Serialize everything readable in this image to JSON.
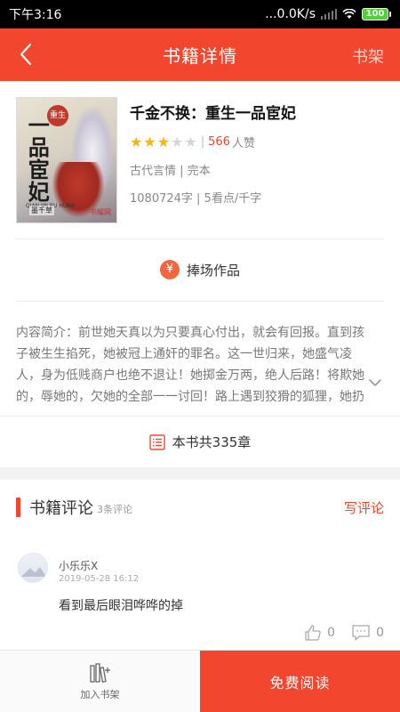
{
  "status_bar": {
    "time": "下午3:16",
    "network_speed": "...0.0K/s",
    "battery": "100"
  },
  "header": {
    "back_icon": "chevron-left-icon",
    "title": "书籍详情",
    "shelf_link": "书架"
  },
  "book": {
    "cover": {
      "title": "一品宦妃",
      "badge": "重生",
      "pinyin": "QIAN JIN BU HUAN",
      "author": "墨千草",
      "publisher": "书耀网"
    },
    "title": "千金不换：重生一品宦妃",
    "rating": 3,
    "rating_max": 5,
    "likes": "566",
    "likes_label": "人赞",
    "category_status": "古代言情 | 完本",
    "words_price": "1080724字 | 5看点/千字"
  },
  "support": {
    "icon": "yen-bag-icon",
    "label": "捧场作品"
  },
  "intro": {
    "text": "内容简介：前世她天真以为只要真心付出，就会有回报。直到孩子被生生掐死，她被冠上通奸的罪名。这一世归来，她盛气凌人，身为低贱商户也绝不退让！她掷金万两，绝人后路！将欺她的，辱她的，欠她的全部一一讨回！路上遇到狡猾的狐狸，她扔过去橄榄枝，“我有…",
    "toggle_icon": "chevron-down-icon"
  },
  "chapters": {
    "icon": "list-icon",
    "label": "本书共335章"
  },
  "comments": {
    "title": "书籍评论",
    "count": "3条评论",
    "write_label": "写评论",
    "items": [
      {
        "user": "小乐乐X",
        "date": "2019-05-28 16:12",
        "text": "看到最后眼泪哗哗的掉",
        "likes": "0",
        "replies": "0"
      }
    ]
  },
  "bottom_bar": {
    "add_shelf_label": "加入书架",
    "read_label": "免费阅读"
  },
  "colors": {
    "accent": "#f2462e",
    "star": "#f5b41a"
  }
}
